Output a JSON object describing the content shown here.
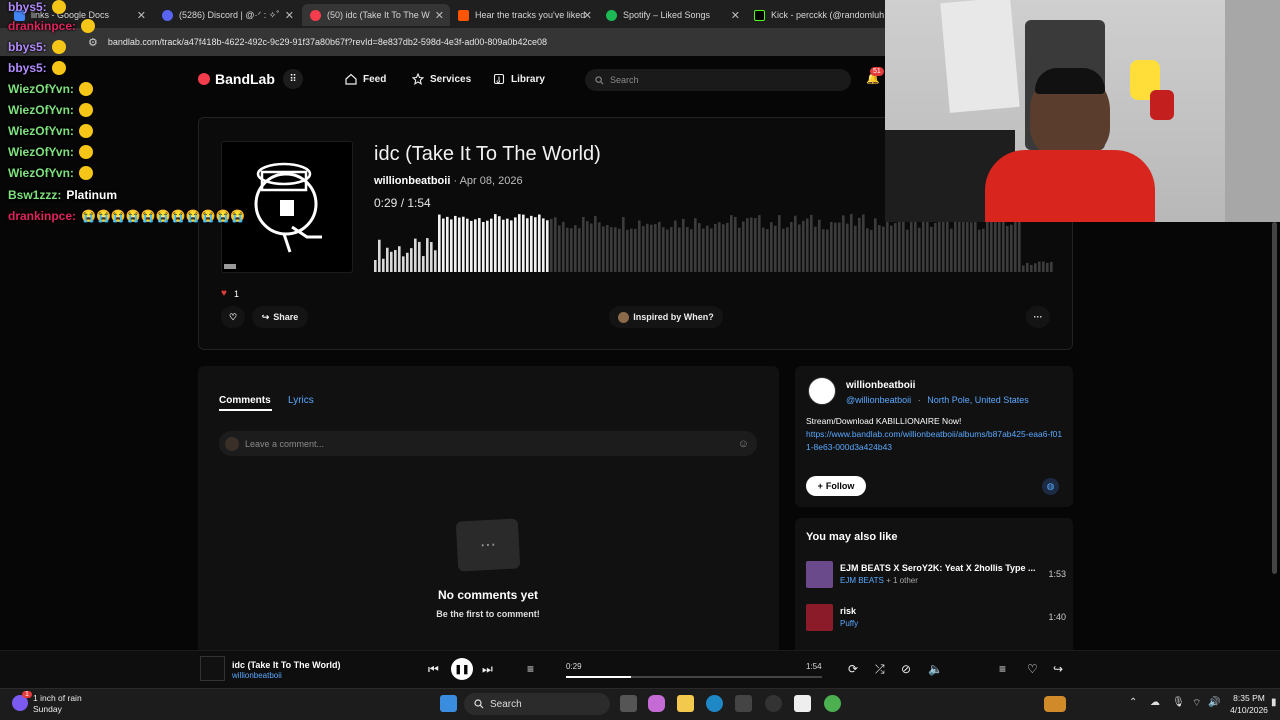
{
  "browser": {
    "tabs": [
      {
        "label": "links - Google Docs",
        "color": "#4285f4"
      },
      {
        "label": "(5286) Discord | @·ᐟ : ✧˚",
        "color": "#5865f2"
      },
      {
        "label": "(50) idc (Take It To The W",
        "color": "#f43c4c"
      },
      {
        "label": "Hear the tracks you've liked",
        "color": "#ff5500"
      },
      {
        "label": "Spotify – Liked Songs",
        "color": "#1db954"
      },
      {
        "label": "Kick - percckk (@randomluh",
        "color": "#53fc18"
      }
    ],
    "url": "bandlab.com/track/a47f418b-4622-492c-9c29-91f37a80b67f?revId=8e837db2-598d-4e3f-ad00-809a0b42ce08"
  },
  "nav": {
    "logo": "BandLab",
    "feed": "Feed",
    "services": "Services",
    "library": "Library",
    "search_placeholder": "Search",
    "notif_count": "51"
  },
  "track": {
    "title": "idc (Take It To The World)",
    "artist": "willionbeatboii",
    "date": "· Apr 08, 2026",
    "current": "0:29",
    "sep": " / ",
    "duration": "1:54",
    "progress_fraction": 0.26,
    "likes": "1",
    "share": "Share",
    "inspired": "Inspired by When?",
    "more": "···"
  },
  "comments": {
    "tab_comments": "Comments",
    "tab_lyrics": "Lyrics",
    "placeholder": "Leave a comment...",
    "empty_title": "No comments yet",
    "empty_sub": "Be the first to comment!"
  },
  "artist_card": {
    "name": "willionbeatboii",
    "handle": "@willionbeatboii",
    "dot": "·",
    "location": "North Pole, United States",
    "bio": "Stream/Download KABILLIONAIRE Now!",
    "link": "https://www.bandlab.com/willionbeatboii/albums/b87ab425-eaa6-f011-8e63-000d3a424b43",
    "follow": "Follow"
  },
  "also_like": {
    "heading": "You may also like",
    "items": [
      {
        "title": "EJM BEATS X SeroY2K: Yeat X 2hollis Type ...",
        "artist": "EJM BEATS",
        "extra": "+ 1 other",
        "duration": "1:53",
        "color": "#6b4a8c"
      },
      {
        "title": "risk",
        "artist": "Puffy",
        "extra": "",
        "duration": "1:40",
        "color": "#8c1b2a"
      }
    ]
  },
  "player": {
    "title": "idc (Take It To The World)",
    "artist": "willionbeatboii",
    "current": "0:29",
    "duration": "1:54"
  },
  "chat": [
    {
      "user": "bbys5:",
      "color": "#b28cff",
      "text": ""
    },
    {
      "user": "drankinpce:",
      "color": "#e0245e",
      "text": ""
    },
    {
      "user": "bbys5:",
      "color": "#b28cff",
      "text": ""
    },
    {
      "user": "bbys5:",
      "color": "#b28cff",
      "text": ""
    },
    {
      "user": "WiezOfYvn:",
      "color": "#7ee07e",
      "text": ""
    },
    {
      "user": "WiezOfYvn:",
      "color": "#7ee07e",
      "text": ""
    },
    {
      "user": "WiezOfYvn:",
      "color": "#7ee07e",
      "text": ""
    },
    {
      "user": "WiezOfYvn:",
      "color": "#7ee07e",
      "text": ""
    },
    {
      "user": "WiezOfYvn:",
      "color": "#7ee07e",
      "text": ""
    },
    {
      "user": "Bsw1zzz:",
      "color": "#7ee07e",
      "text": "Platinum"
    },
    {
      "user": "drankinpce:",
      "color": "#e0245e",
      "text": "😭😭😭😭😭😭😭😭😭😭😭"
    }
  ],
  "taskbar": {
    "weather_line1": "1 inch of rain",
    "weather_line2": "Sunday",
    "weather_badge": "1",
    "search": "Search",
    "time": "8:35 PM",
    "date": "4/10/2026"
  }
}
